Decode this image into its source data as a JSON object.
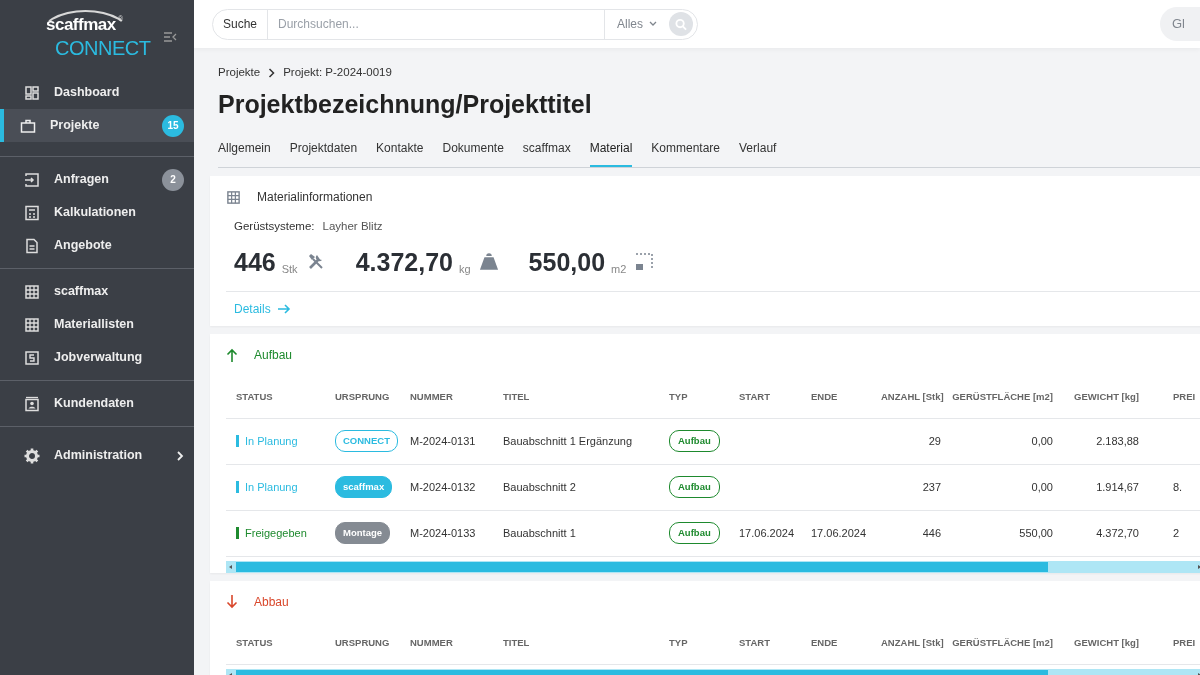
{
  "logo": {
    "top": "scaffmax",
    "mark": "®",
    "bottom": "CONNECT"
  },
  "sidebar": {
    "groups": [
      [
        {
          "label": "Dashboard",
          "selected": false
        },
        {
          "label": "Projekte",
          "selected": true,
          "badge": "15"
        }
      ],
      [
        {
          "label": "Anfragen",
          "selected": false,
          "badge": "2"
        },
        {
          "label": "Kalkulationen",
          "selected": false
        },
        {
          "label": "Angebote",
          "selected": false
        }
      ],
      [
        {
          "label": "scaffmax",
          "selected": false
        },
        {
          "label": "Materiallisten",
          "selected": false
        },
        {
          "label": "Jobverwaltung",
          "selected": false
        }
      ],
      [
        {
          "label": "Kundendaten",
          "selected": false
        }
      ],
      [
        {
          "label": "Administration",
          "selected": false,
          "submenu": true
        }
      ]
    ]
  },
  "search": {
    "label": "Suche",
    "placeholder": "Durchsuchen...",
    "scope": "Alles"
  },
  "user": {
    "initials": "Gl"
  },
  "breadcrumb": [
    "Projekte",
    "Projekt: P-2024-0019"
  ],
  "title": "Projektbezeichnung/Projekttitel",
  "tabs": [
    {
      "label": "Allgemein",
      "selected": false
    },
    {
      "label": "Projektdaten",
      "selected": false
    },
    {
      "label": "Kontakte",
      "selected": false
    },
    {
      "label": "Dokumente",
      "selected": false
    },
    {
      "label": "scaffmax",
      "selected": false
    },
    {
      "label": "Material",
      "selected": true
    },
    {
      "label": "Kommentare",
      "selected": false
    },
    {
      "label": "Verlauf",
      "selected": false
    }
  ],
  "material": {
    "title": "Materialinformationen",
    "system_label": "Gerüstsysteme:",
    "system": "Layher Blitz",
    "stats": [
      {
        "value": "446",
        "unit": "Stk"
      },
      {
        "value": "4.372,70",
        "unit": "kg"
      },
      {
        "value": "550,00",
        "unit": "m2"
      }
    ],
    "details": "Details"
  },
  "sections": [
    {
      "kind": "up",
      "title": "Aufbau",
      "columns": [
        "STATUS",
        "URSPRUNG",
        "NUMMER",
        "TITEL",
        "TYP",
        "START",
        "ENDE",
        "ANZAHL [Stk]",
        "GERÜSTFLÄCHE [m2]",
        "GEWICHT [kg]",
        "PREI"
      ],
      "rows": [
        {
          "status": "In Planung",
          "color": "#2bbbe0",
          "origin": {
            "label": "CONNECT",
            "kind": "outline"
          },
          "number": "M-2024-0131",
          "title": "Bauabschnitt 1 Ergänzung",
          "type": "Aufbau",
          "count": "29",
          "area": "0,00",
          "weight": "2.183,88"
        },
        {
          "status": "In Planung",
          "color": "#2bbbe0",
          "origin": {
            "label": "scaffmax",
            "kind": "filled"
          },
          "number": "M-2024-0132",
          "title": "Bauabschnitt 2",
          "type": "Aufbau",
          "count": "237",
          "area": "0,00",
          "weight": "1.914,67",
          "price": "8."
        },
        {
          "status": "Freigegeben",
          "color": "#1e8a2e",
          "origin": {
            "label": "Montage",
            "kind": "neutral"
          },
          "number": "M-2024-0133",
          "title": "Bauabschnitt 1",
          "type": "Aufbau",
          "start": "17.06.2024",
          "end": "17.06.2024",
          "count": "446",
          "area": "550,00",
          "weight": "4.372,70",
          "price": "2"
        }
      ]
    },
    {
      "kind": "down",
      "title": "Abbau",
      "columns": [
        "STATUS",
        "URSPRUNG",
        "NUMMER",
        "TITEL",
        "TYP",
        "START",
        "ENDE",
        "ANZAHL [Stk]",
        "GERÜSTFLÄCHE [m2]",
        "GEWICHT [kg]",
        "PREI"
      ]
    }
  ]
}
